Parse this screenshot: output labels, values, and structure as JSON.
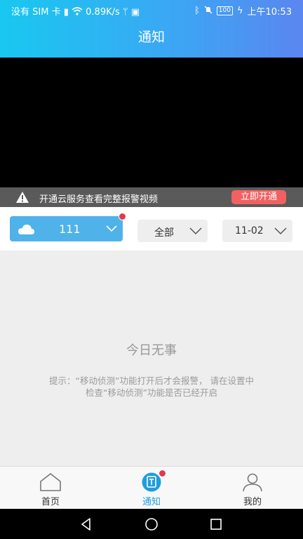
{
  "status_bar": {
    "left": "没有 SIM 卡",
    "speed": "0.89K/s",
    "battery": "100",
    "time": "上午10:53"
  },
  "header": {
    "title": "通知"
  },
  "banner": {
    "text": "开通云服务查看完整报警视频",
    "button": "立即开通"
  },
  "filters": {
    "camera": {
      "label": "111",
      "icon": "cloud-icon",
      "has_badge": true
    },
    "type": {
      "value": "全部"
    },
    "date": {
      "value": "11-02"
    }
  },
  "empty_state": {
    "heading": "今日无事",
    "hint_line1": "提示：“移动侦测”功能打开后才会报警，  请在设置中",
    "hint_line2": "检查“移动侦测”功能是否已经开启"
  },
  "tabbar": {
    "items": [
      {
        "label": "首页",
        "icon": "home-icon",
        "active": false
      },
      {
        "label": "通知",
        "icon": "notification-icon",
        "active": true
      },
      {
        "label": "我的",
        "icon": "profile-icon",
        "active": false
      }
    ]
  },
  "colors": {
    "header_gradient_start": "#18c8f0",
    "header_gradient_end": "#5a86f0",
    "accent": "#1f9edb",
    "camera_button": "#4fb2e9",
    "cta_button": "#f06262",
    "badge": "#e53850"
  }
}
